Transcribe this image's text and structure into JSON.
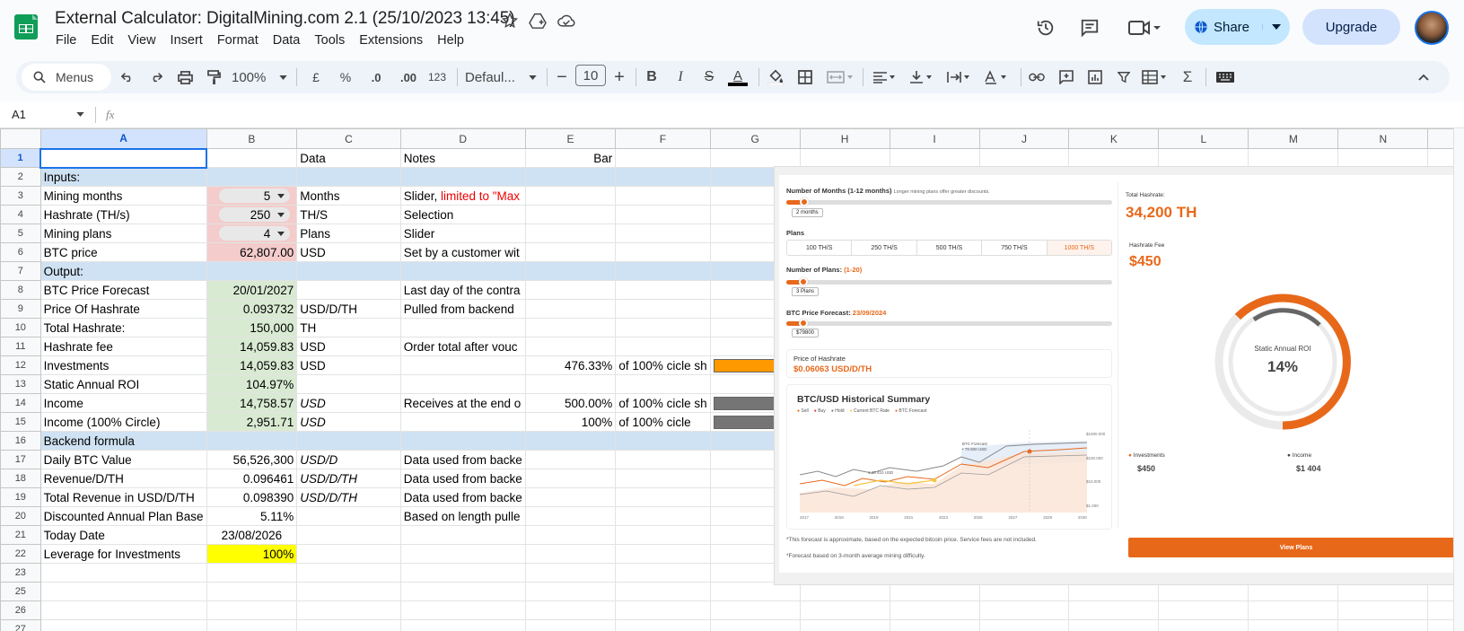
{
  "app": {
    "title": "External Calculator: DigitalMining.com 2.1 (25/10/2023 13:45)",
    "menus": [
      "File",
      "Edit",
      "View",
      "Insert",
      "Format",
      "Data",
      "Tools",
      "Extensions",
      "Help"
    ],
    "share_label": "Share",
    "upgrade_label": "Upgrade"
  },
  "toolbar": {
    "search_label": "Menus",
    "zoom": "100%",
    "currency": "£",
    "percent": "%",
    "dec_decrease": ".0",
    "dec_increase": ".00",
    "number_format": "123",
    "font": "Defaul...",
    "font_size": "10",
    "bold": "B",
    "italic": "I",
    "strike": "S",
    "text_color": "A",
    "sigma": "Σ"
  },
  "formula": {
    "cell_ref": "A1",
    "fx": "fx",
    "content": ""
  },
  "sheet": {
    "columns": [
      "A",
      "B",
      "C",
      "D",
      "E",
      "F",
      "G",
      "H",
      "I",
      "J",
      "K",
      "L",
      "M",
      "N"
    ],
    "rows": [
      {
        "n": "1",
        "a": "",
        "b": "",
        "c": "Data",
        "d": "Notes",
        "e": "Bar",
        "f": "",
        "style": "hdr"
      },
      {
        "n": "2",
        "a": "Inputs:",
        "b": "",
        "c": "",
        "d": "",
        "e": "",
        "f": "",
        "style": "sec"
      },
      {
        "n": "3",
        "a": "Mining months",
        "b": "5",
        "c": "Months",
        "d": "Slider, ",
        "d2": "limited to \"Max",
        "e": "",
        "f": "",
        "style": "pinkchip"
      },
      {
        "n": "4",
        "a": "Hashrate (TH/s)",
        "b": "250",
        "c": "TH/S",
        "d": "Selection",
        "e": "",
        "f": "",
        "style": "pinkchip"
      },
      {
        "n": "5",
        "a": "Mining plans",
        "b": "4",
        "c": "Plans",
        "d": "Slider",
        "e": "",
        "f": "",
        "style": "pinkchip"
      },
      {
        "n": "6",
        "a": "BTC price",
        "b": "62,807.00",
        "c": "USD",
        "d": "Set by a customer wit",
        "e": "",
        "f": "",
        "style": "pink"
      },
      {
        "n": "7",
        "a": "Output:",
        "b": "",
        "c": "",
        "d": "",
        "e": "",
        "f": "",
        "style": "sec"
      },
      {
        "n": "8",
        "a": "BTC Price Forecast",
        "b": "20/01/2027",
        "c": "",
        "d": "Last day of the contra",
        "e": "",
        "f": "",
        "style": "green"
      },
      {
        "n": "9",
        "a": "Price Of Hashrate",
        "b": "0.093732",
        "c": "USD/D/TH",
        "d": "Pulled from backend",
        "e": "",
        "f": "",
        "style": "green"
      },
      {
        "n": "10",
        "a": "Total Hashrate:",
        "b": "150,000",
        "c": "TH",
        "d": "",
        "e": "",
        "f": "",
        "style": "green"
      },
      {
        "n": "11",
        "a": "Hashrate fee",
        "b": "14,059.83",
        "c": "USD",
        "d": "Order total after vouc",
        "e": "",
        "f": "",
        "style": "green"
      },
      {
        "n": "12",
        "a": "Investments",
        "b": "14,059.83",
        "c": "USD",
        "d": "",
        "e": "476.33%",
        "f": "of 100% cicle sh",
        "style": "green",
        "bar": "orange"
      },
      {
        "n": "13",
        "a": "Static Annual ROI",
        "b": "104.97%",
        "c": "",
        "d": "",
        "e": "",
        "f": "",
        "style": "green"
      },
      {
        "n": "14",
        "a": "Income",
        "b": "14,758.57",
        "c": "USD",
        "d": "Receives at the end o",
        "e": "500.00%",
        "f": "of 100% cicle sh",
        "style": "green",
        "ci": true,
        "bar": "grey"
      },
      {
        "n": "15",
        "a": "Income (100% Circle)",
        "b": "2,951.71",
        "c": "USD",
        "d": "",
        "e": "100%",
        "f": "of 100% cicle",
        "style": "green",
        "ci": true,
        "bar": "grey"
      },
      {
        "n": "16",
        "a": "Backend formula",
        "b": "",
        "c": "",
        "d": "",
        "e": "",
        "f": "",
        "style": "sec"
      },
      {
        "n": "17",
        "a": "Daily BTC Value",
        "b": "56,526,300",
        "c": "USD/D",
        "d": "Data used from backe",
        "e": "",
        "f": "",
        "ci": true
      },
      {
        "n": "18",
        "a": "Revenue/D/TH",
        "b": "0.096461",
        "c": "USD/D/TH",
        "d": "Data used from backe",
        "e": "",
        "f": "",
        "ci": true
      },
      {
        "n": "19",
        "a": "Total Revenue in USD/D/TH",
        "b": "0.098390",
        "c": "USD/D/TH",
        "d": "Data used from backe",
        "e": "",
        "f": "",
        "ci": true
      },
      {
        "n": "20",
        "a": "Discounted Annual Plan Base",
        "b": "5.11%",
        "c": "",
        "d": "Based on length pulle",
        "e": "",
        "f": ""
      },
      {
        "n": "21",
        "a": "Today Date",
        "b": "23/08/2026",
        "c": "",
        "d": "",
        "e": "",
        "f": "",
        "bcenter": true
      },
      {
        "n": "22",
        "a": "Leverage for Investments",
        "b": "100%",
        "c": "",
        "d": "",
        "e": "",
        "f": "",
        "style": "yellow"
      },
      {
        "n": "23",
        "a": "",
        "b": "",
        "c": "",
        "d": "",
        "e": "",
        "f": ""
      },
      {
        "n": "25",
        "a": "",
        "b": "",
        "c": "",
        "d": "",
        "e": "",
        "f": ""
      },
      {
        "n": "26",
        "a": "",
        "b": "",
        "c": "",
        "d": "",
        "e": "",
        "f": ""
      },
      {
        "n": "27",
        "a": "",
        "b": "",
        "c": "",
        "d": "",
        "e": "",
        "f": ""
      }
    ]
  },
  "calc": {
    "months_label": "Number of Months (1-12 months)",
    "months_hint": "Longer mining plans offer greater discounts.",
    "months_value": "2 months",
    "plans_label": "Plans",
    "plan_options": [
      "100 TH/S",
      "250 TH/S",
      "500 TH/S",
      "750 TH/S",
      "1000 TH/S"
    ],
    "num_plans_label": "Number of Plans:",
    "num_plans_range": "(1-20)",
    "num_plans_value": "3 Plans",
    "forecast_label": "BTC Price Forecast:",
    "forecast_date": "23/09/2024",
    "forecast_value": "$79800",
    "price_hashrate_label": "Price of Hashrate",
    "price_hashrate_value": "$0.06063 USD/D/TH",
    "history_title": "BTC/USD Historical Summary",
    "legend": [
      "Sell",
      "Buy",
      "Hold",
      "Current BTC Rate",
      "BTC Forecast"
    ],
    "years": [
      "2017",
      "2018",
      "2019",
      "2021",
      "2023",
      "2025",
      "2027",
      "2029",
      "2030"
    ],
    "yaxis": [
      "$1000.000",
      "$100.000",
      "$10.000",
      "$1.000"
    ],
    "annot_forecast": "BTC Forecast",
    "annot_forecast_val": "• 79 800 USD",
    "annot_current": "1 25 410 USD",
    "total_hashrate_label": "Total Hashrate:",
    "total_hashrate_value": "34,200 TH",
    "hashrate_fee_label": "Hashrate Fee",
    "hashrate_fee_value": "$450",
    "roi_label": "Static Annual ROI",
    "roi_value": "14%",
    "investments_label": "Investments",
    "investments_value": "$450",
    "income_label": "Income",
    "income_value": "$1 404",
    "footnote1": "*This forecast is approximate, based on the expected bitcoin price. Service fees are not included.",
    "footnote2": "*Forecast based on 3-month average mining difficulty.",
    "cta": "View Plans",
    "accent": "#e8681a"
  },
  "colors": {
    "accent_blue": "#0b57d0",
    "share_bg": "#c2e7ff",
    "section_blue": "#cfe2f3",
    "input_pink": "#f4cccc",
    "output_green": "#d9ead3",
    "bar_orange": "#ff9900",
    "bar_grey": "#757575"
  }
}
